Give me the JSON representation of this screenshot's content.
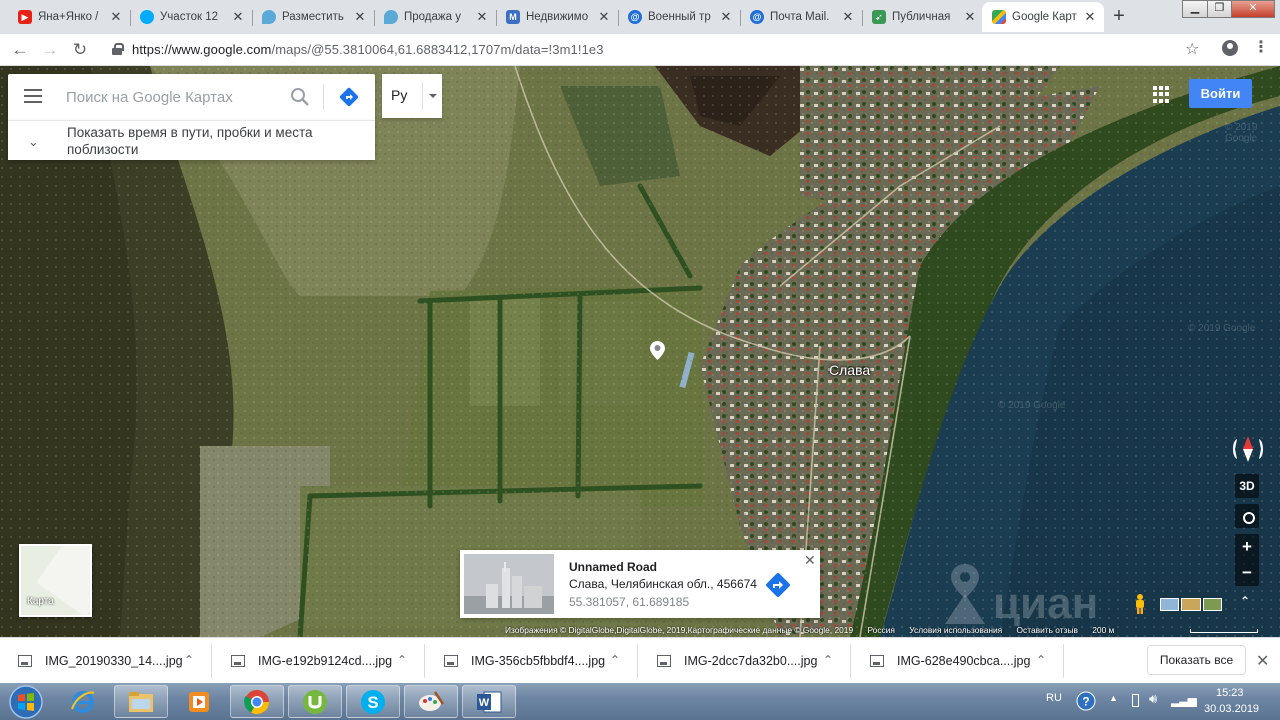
{
  "browser": {
    "tabs": [
      {
        "title": "Яна+Янко /",
        "favicon": "youtube-icon",
        "color": "#e62117"
      },
      {
        "title": "Участок 12",
        "favicon": "avito-icon",
        "color": "#00aaff"
      },
      {
        "title": "Разместить",
        "favicon": "map-pin-icon",
        "color": "#5aa9d6"
      },
      {
        "title": "Продажа у",
        "favicon": "map-pin-icon",
        "color": "#5aa9d6"
      },
      {
        "title": "Недвижимо",
        "favicon": "m-icon",
        "color": "#3a6fc4"
      },
      {
        "title": "Военный тр",
        "favicon": "mail-icon",
        "color": "#1e6fd9"
      },
      {
        "title": "Почта Mail.",
        "favicon": "mail-icon",
        "color": "#1e6fd9"
      },
      {
        "title": "Публичная",
        "favicon": "arrow-icon",
        "color": "#3a9a55"
      },
      {
        "title": "Google Карт",
        "favicon": "google-maps-icon",
        "color": "#34a853",
        "active": true
      }
    ],
    "url_host": "https://www.google.com",
    "url_path": "/maps/@55.3810064,61.6883412,1707m/data=!3m1!1e3"
  },
  "maps": {
    "search_placeholder": "Поиск на Google Картах",
    "traffic_text": "Показать время в пути, пробки и места поблизости",
    "language_label": "Ру",
    "signin_label": "Войти",
    "place_label": "Слава",
    "btn_3d": "3D",
    "minimap_label": "Карта",
    "watermark": "© 2019 Google",
    "card": {
      "title": "Unnamed Road",
      "address": "Слава, Челябинская обл., 456674",
      "coords": "55.381057, 61.689185"
    },
    "attribution": {
      "imagery": "Изображения © DigitalGlobe,DigitalGlobe, 2019,Картографические данные © Google, 2019",
      "country": "Россия",
      "terms": "Условия использования",
      "feedback": "Оставить отзыв",
      "scale": "200 м"
    }
  },
  "downloads": {
    "items": [
      {
        "name": "IMG_20190330_14....jpg"
      },
      {
        "name": "IMG-e192b9124cd....jpg"
      },
      {
        "name": "IMG-356cb5fbbdf4....jpg"
      },
      {
        "name": "IMG-2dcc7da32b0....jpg"
      },
      {
        "name": "IMG-628e490cbca....jpg"
      }
    ],
    "show_all": "Показать все"
  },
  "taskbar": {
    "apps": [
      "explorer-icon",
      "internet-explorer-icon",
      "file-manager-icon",
      "media-player-icon",
      "chrome-icon",
      "utorrent-icon",
      "skype-icon",
      "paint-icon",
      "word-icon"
    ],
    "language": "RU",
    "time": "15:23",
    "date": "30.03.2019"
  }
}
